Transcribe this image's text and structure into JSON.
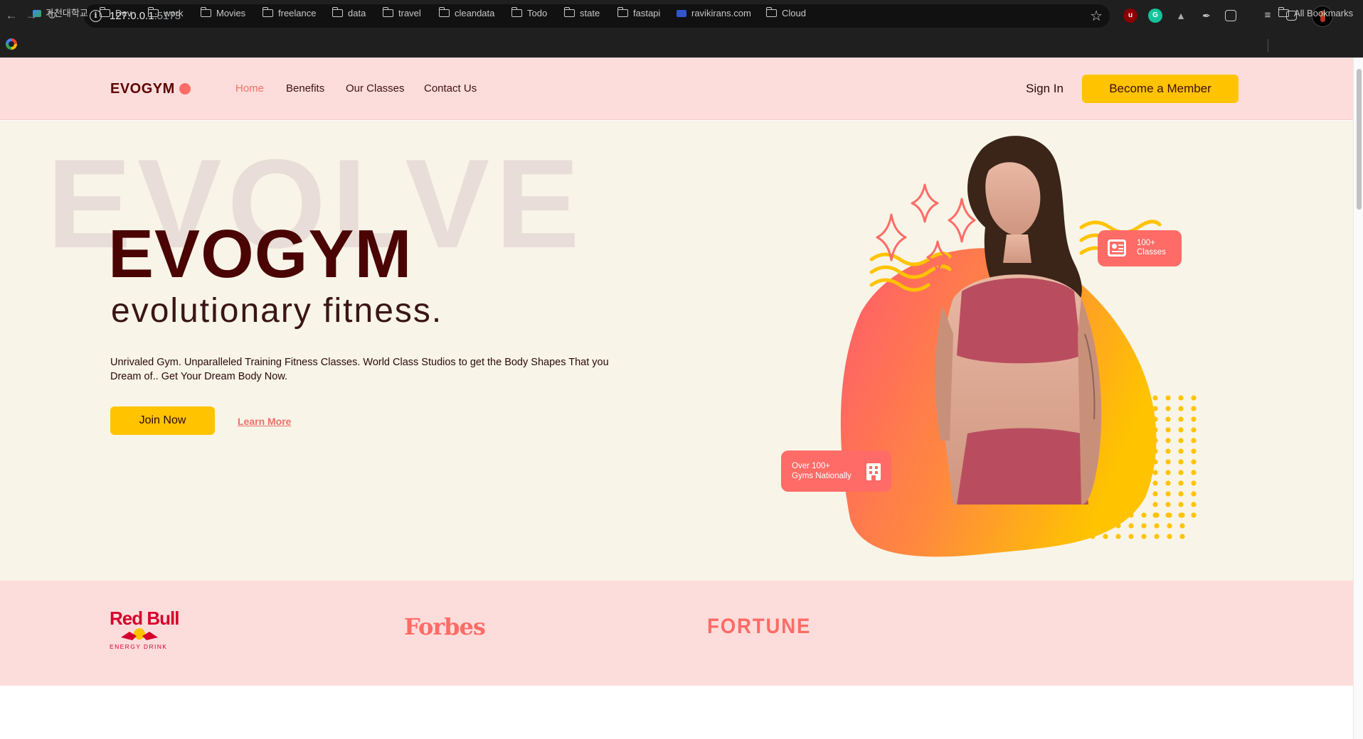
{
  "browser": {
    "url_host": "127.0.0.1",
    "url_port": ":5173",
    "bookmarks": [
      {
        "label": "가천대학교",
        "type": "site"
      },
      {
        "label": "Dev",
        "type": "folder"
      },
      {
        "label": "work",
        "type": "folder"
      },
      {
        "label": "Movies",
        "type": "folder"
      },
      {
        "label": "freelance",
        "type": "folder"
      },
      {
        "label": "data",
        "type": "folder"
      },
      {
        "label": "travel",
        "type": "folder"
      },
      {
        "label": "cleandata",
        "type": "folder"
      },
      {
        "label": "Todo",
        "type": "folder"
      },
      {
        "label": "state",
        "type": "folder"
      },
      {
        "label": "fastapi",
        "type": "folder"
      },
      {
        "label": "ravikirans.com",
        "type": "site"
      },
      {
        "label": "Cloud",
        "type": "folder"
      }
    ],
    "all_bookmarks_label": "All Bookmarks",
    "extensions": [
      "ublock-icon",
      "grammarly-icon",
      "extension-icon",
      "feather-icon",
      "puzzle-icon",
      "reading-list-icon",
      "side-panel-icon"
    ]
  },
  "navbar": {
    "logo": "EVOGYM",
    "links": [
      {
        "label": "Home",
        "active": true
      },
      {
        "label": "Benefits",
        "active": false
      },
      {
        "label": "Our Classes",
        "active": false
      },
      {
        "label": "Contact Us",
        "active": false
      }
    ],
    "sign_in": "Sign In",
    "cta": "Become a Member"
  },
  "hero": {
    "background_word": "EVOLVE",
    "title": "EVOGYM",
    "subtitle": "evolutionary fitness.",
    "description": "Unrivaled Gym. Unparalleled Training Fitness Classes. World Class Studios to get the Body Shapes That you Dream of.. Get Your Dream Body Now.",
    "join_label": "Join Now",
    "learn_more_label": "Learn More",
    "badge_classes": {
      "line1": "100+",
      "line2": "Classes"
    },
    "badge_gyms": {
      "line1": "Over 100+",
      "line2": "Gyms Nationally"
    }
  },
  "sponsors": {
    "redbull": {
      "name": "Red Bull",
      "sub": "ENERGY DRINK"
    },
    "forbes": "Forbes",
    "fortune": "FORTUNE"
  },
  "colors": {
    "primary_pink": "#fddddb",
    "accent_coral": "#ff6b66",
    "accent_yellow": "#ffc300",
    "deep_maroon": "#4a0404",
    "hero_bg": "#f8f4e8"
  }
}
